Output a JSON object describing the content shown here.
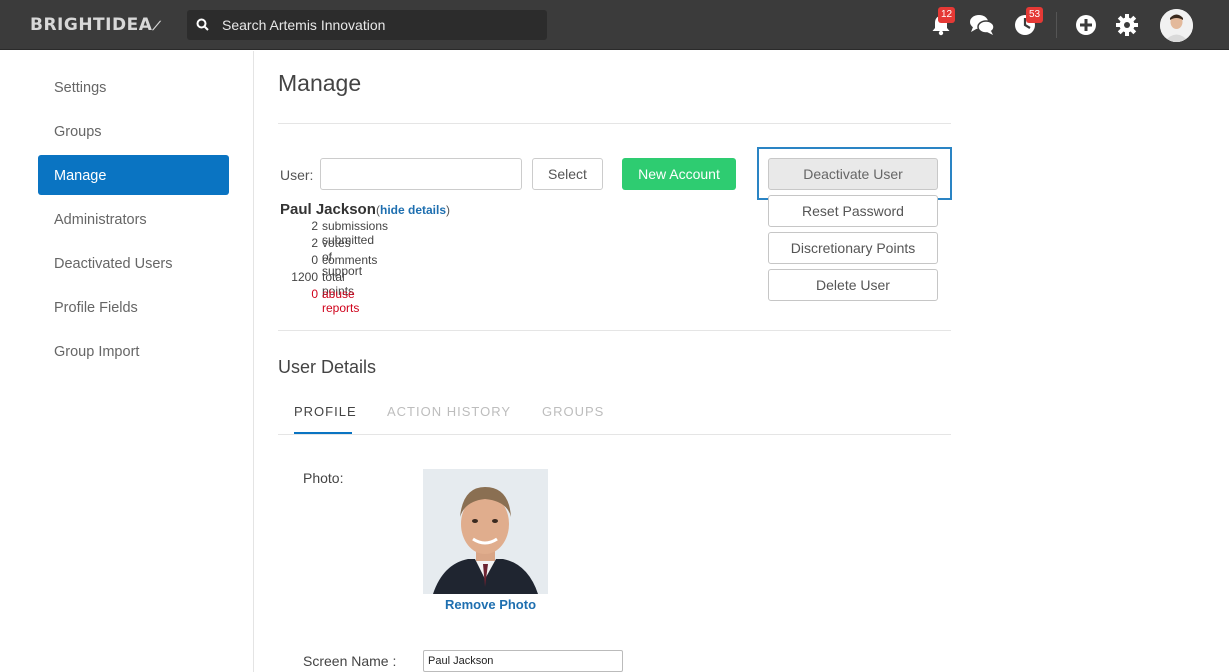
{
  "topbar": {
    "logo": "BRIGHTIDEA",
    "search_placeholder": "Search Artemis Innovation",
    "notifications_count": "12",
    "activity_count": "53",
    "icons": [
      "search-icon",
      "bell-icon",
      "chat-icon",
      "activity-icon",
      "add-icon",
      "gear-icon",
      "avatar"
    ]
  },
  "sidebar": {
    "items": [
      {
        "label": "Settings"
      },
      {
        "label": "Groups"
      },
      {
        "label": "Manage"
      },
      {
        "label": "Administrators"
      },
      {
        "label": "Deactivated Users"
      },
      {
        "label": "Profile Fields"
      },
      {
        "label": "Group Import"
      }
    ],
    "active": "Manage"
  },
  "main": {
    "title": "Manage",
    "user_label": "User:",
    "user_input_value": "",
    "select_label": "Select",
    "new_account_label": "New Account",
    "actions": {
      "deactivate": "Deactivate User",
      "reset": "Reset Password",
      "points": "Discretionary Points",
      "delete": "Delete User"
    },
    "user": {
      "name": "Paul Jackson",
      "hide_details": "hide details",
      "stats": [
        {
          "num": "2",
          "label": "submissions submitted"
        },
        {
          "num": "2",
          "label": "votes of support"
        },
        {
          "num": "0",
          "label": "comments"
        },
        {
          "num": "1200",
          "label": "total points"
        },
        {
          "num": "0",
          "label": "abuse reports"
        }
      ]
    },
    "details": {
      "title": "User Details",
      "tabs": [
        "PROFILE",
        "ACTION HISTORY",
        "GROUPS"
      ],
      "photo_label": "Photo:",
      "remove_photo": "Remove Photo",
      "screen_name_label": "Screen Name :",
      "screen_name_value": "Paul Jackson"
    }
  },
  "colors": {
    "topbar": "#3b3b3b",
    "accent": "#0a74c2",
    "new_account": "#2ecc71",
    "badge": "#e53935",
    "alert": "#d0021b"
  }
}
